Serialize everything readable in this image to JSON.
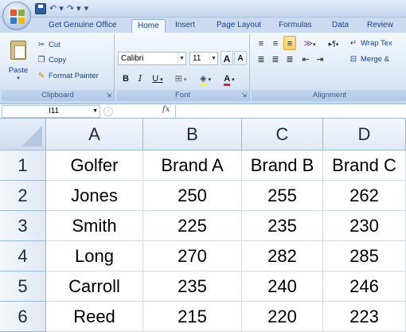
{
  "quick_access": {
    "save_icon": "save-icon",
    "undo_glyph": "↶ ▾",
    "redo_glyph": "↷ ▾",
    "customize_glyph": "▾"
  },
  "tabs": [
    {
      "label": "Get Genuine Office",
      "active": false
    },
    {
      "label": "Home",
      "active": true
    },
    {
      "label": "Insert",
      "active": false
    },
    {
      "label": "Page Layout",
      "active": false
    },
    {
      "label": "Formulas",
      "active": false
    },
    {
      "label": "Data",
      "active": false
    },
    {
      "label": "Review",
      "active": false
    }
  ],
  "clipboard": {
    "paste_label": "Paste",
    "cut_label": "Cut",
    "copy_label": "Copy",
    "format_painter_label": "Format Painter",
    "group_label": "Clipboard"
  },
  "font": {
    "font_name": "Calibri",
    "font_size": "11",
    "grow_label": "A",
    "shrink_label": "A",
    "bold_label": "B",
    "italic_label": "I",
    "underline_label": "U",
    "font_color_label": "A",
    "group_label": "Font"
  },
  "alignment": {
    "wrap_text_label": "Wrap Tex",
    "merge_label": "Merge &",
    "group_label": "Alignment"
  },
  "formula_bar": {
    "name_box_value": "I11",
    "fx_label": "fx",
    "formula_value": ""
  },
  "columns": [
    "A",
    "B",
    "C",
    "D"
  ],
  "rows": [
    {
      "num": "1",
      "cells": [
        "Golfer",
        "Brand A",
        "Brand B",
        "Brand C"
      ]
    },
    {
      "num": "2",
      "cells": [
        "Jones",
        "250",
        "255",
        "262"
      ]
    },
    {
      "num": "3",
      "cells": [
        "Smith",
        "225",
        "235",
        "230"
      ]
    },
    {
      "num": "4",
      "cells": [
        "Long",
        "270",
        "282",
        "285"
      ]
    },
    {
      "num": "5",
      "cells": [
        "Carroll",
        "235",
        "240",
        "246"
      ]
    },
    {
      "num": "6",
      "cells": [
        "Reed",
        "215",
        "220",
        "223"
      ]
    }
  ],
  "colors": {
    "ribbon_blue": "#dbe7f6",
    "header_text": "#15428b",
    "grid_line": "#d0d7e5"
  }
}
